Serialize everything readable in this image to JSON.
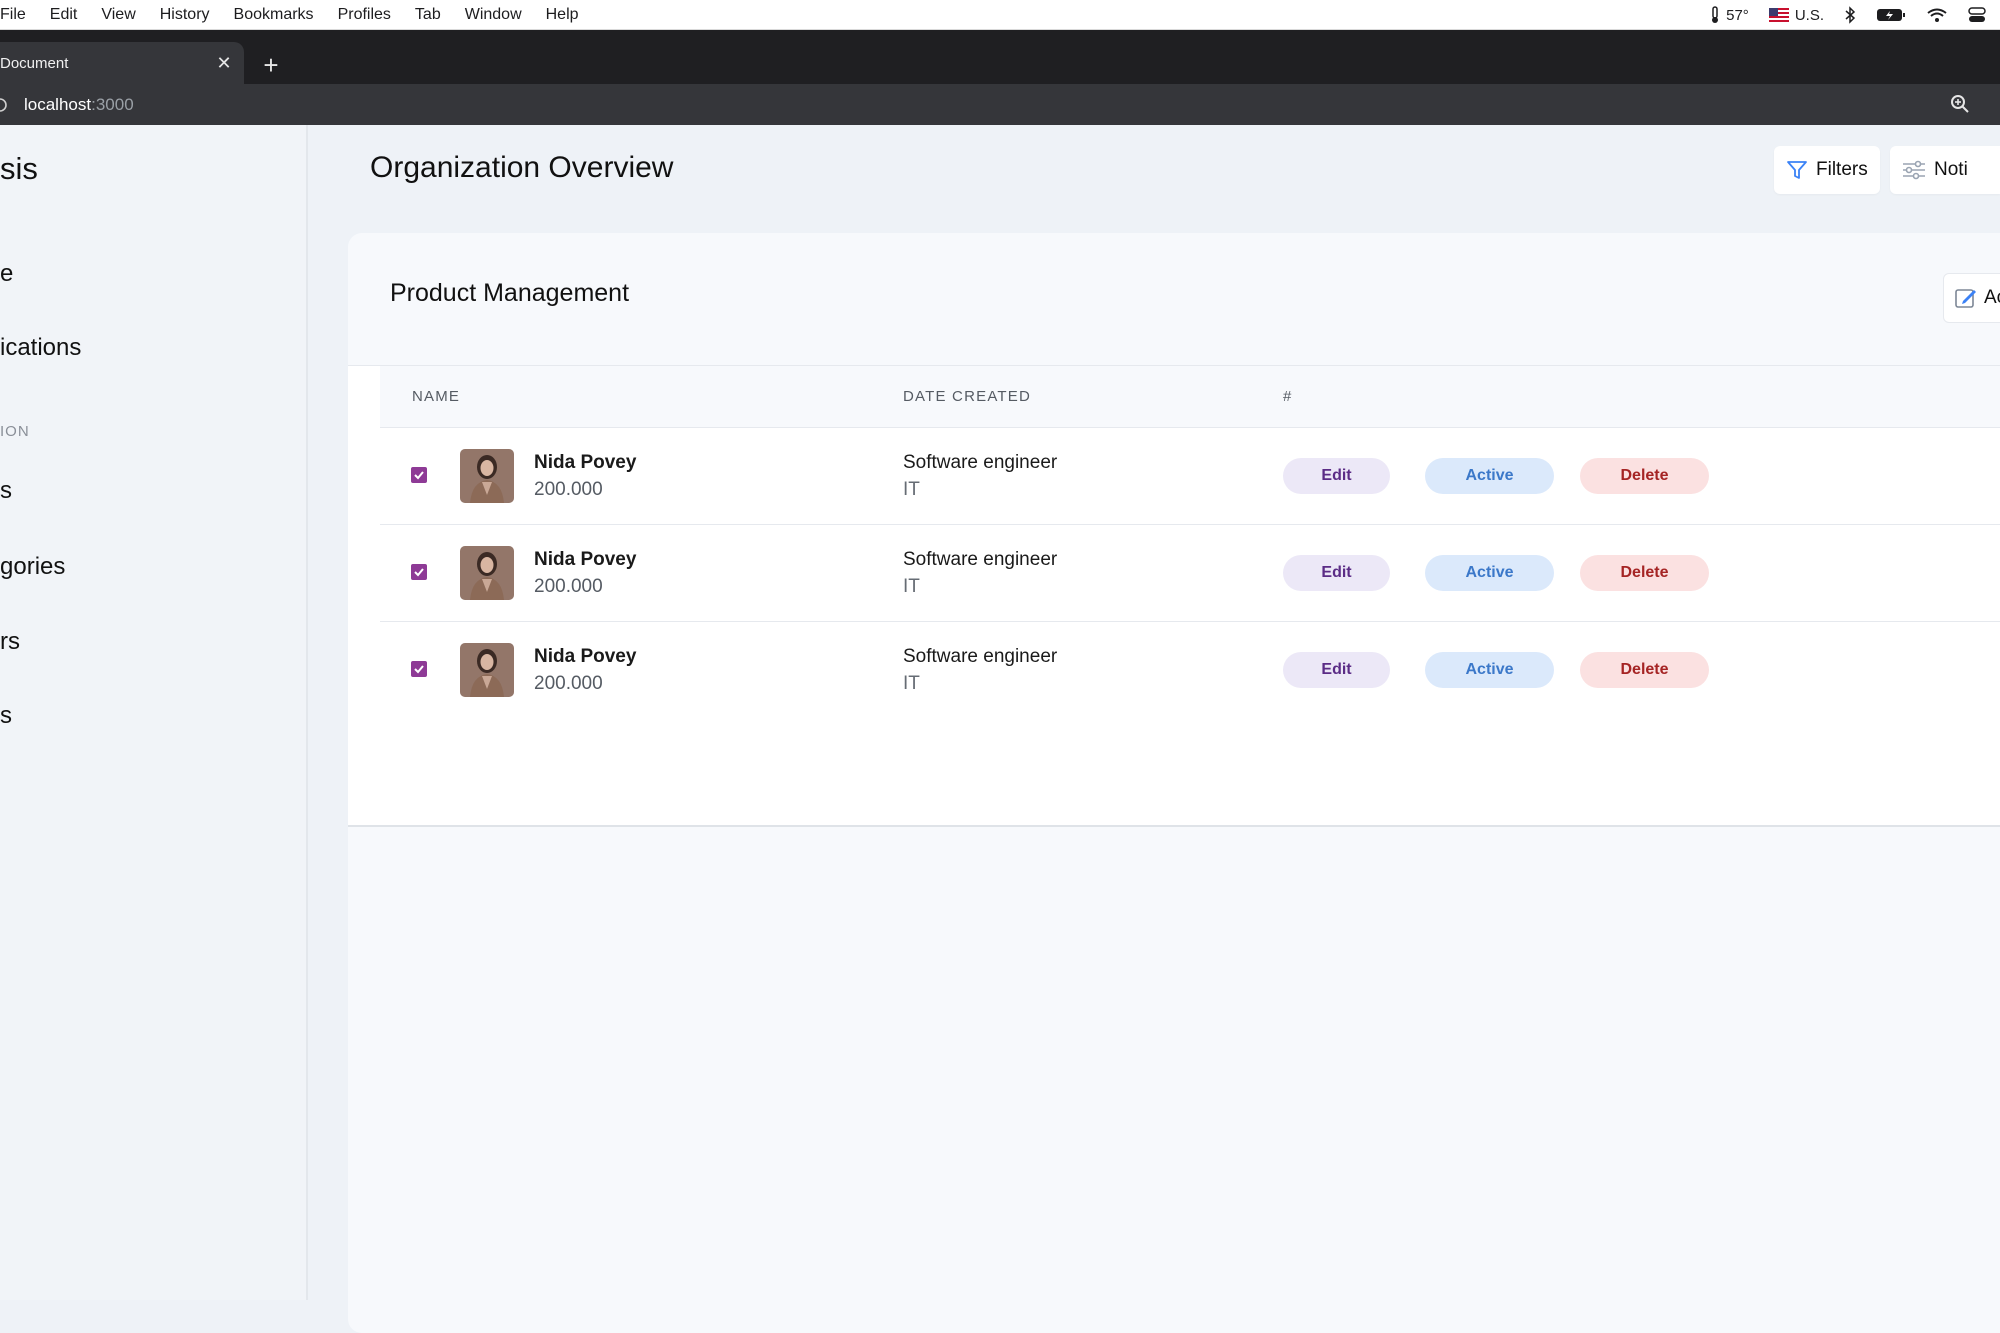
{
  "menubar": {
    "items": [
      "File",
      "Edit",
      "View",
      "History",
      "Bookmarks",
      "Profiles",
      "Tab",
      "Window",
      "Help"
    ],
    "weather": "57°",
    "keyboard": "U.S."
  },
  "browser": {
    "tab_title": "Document",
    "tab_close": "✕",
    "new_tab": "+",
    "url_host": "localhost",
    "url_port": ":3000"
  },
  "sidebar": {
    "brand": "sis",
    "nav_top": [
      "e",
      "ications"
    ],
    "section_label": "ION",
    "nav_bottom": [
      "s",
      "gories",
      "rs",
      "s"
    ]
  },
  "header": {
    "title": "Organization Overview",
    "filters_label": "Filters",
    "notifications_label": "Noti"
  },
  "card": {
    "title": "Product Management",
    "add_label": "Ac"
  },
  "table": {
    "columns": [
      "NAME",
      "DATE CREATED",
      "#"
    ],
    "rows": [
      {
        "name": "Nida Povey",
        "amount": "200.000",
        "job": "Software engineer",
        "dept": "IT",
        "edit": "Edit",
        "status": "Active",
        "delete": "Delete",
        "checked": true
      },
      {
        "name": "Nida Povey",
        "amount": "200.000",
        "job": "Software engineer",
        "dept": "IT",
        "edit": "Edit",
        "status": "Active",
        "delete": "Delete",
        "checked": true
      },
      {
        "name": "Nida Povey",
        "amount": "200.000",
        "job": "Software engineer",
        "dept": "IT",
        "edit": "Edit",
        "status": "Active",
        "delete": "Delete",
        "checked": true
      }
    ]
  },
  "colors": {
    "checkbox": "#8e3a96",
    "edit_bg": "#ece8f7",
    "active_bg": "#dbe9fb",
    "delete_bg": "#fbe1e1"
  },
  "icons": {
    "filters": "filter-icon",
    "notifications": "sliders-icon",
    "add": "edit-square-icon",
    "zoom": "zoom-icon"
  }
}
